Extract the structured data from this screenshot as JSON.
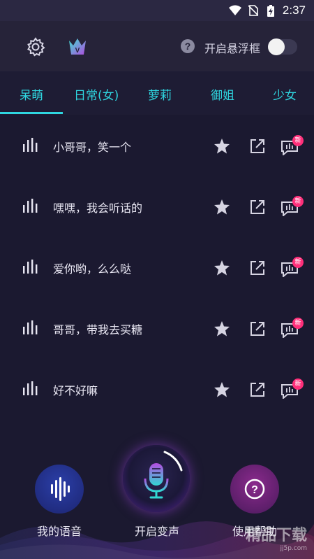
{
  "status_bar": {
    "time": "2:37"
  },
  "header": {
    "floating_window_label": "开启悬浮框",
    "help_symbol": "?"
  },
  "tabs": [
    {
      "label": "呆萌",
      "active": true
    },
    {
      "label": "日常(女)",
      "active": false
    },
    {
      "label": "萝莉",
      "active": false
    },
    {
      "label": "御姐",
      "active": false
    },
    {
      "label": "少女",
      "active": false
    }
  ],
  "voice_list": [
    {
      "label": "小哥哥，笑一个",
      "badge": "新"
    },
    {
      "label": "嘿嘿，我会听话的",
      "badge": "新"
    },
    {
      "label": "爱你哟，么么哒",
      "badge": "新"
    },
    {
      "label": "哥哥，带我去买糖",
      "badge": "新"
    },
    {
      "label": "好不好嘛",
      "badge": "新"
    }
  ],
  "bottom_nav": {
    "my_voice_label": "我的语音",
    "start_change_label": "开启变声",
    "help_label": "使用帮助",
    "help_symbol": "?"
  },
  "watermark": {
    "text": "精品下载",
    "sub": "jj5p.com"
  },
  "colors": {
    "accent": "#2fd6e0",
    "badge": "#ff2f7a",
    "background": "#1b1930"
  }
}
